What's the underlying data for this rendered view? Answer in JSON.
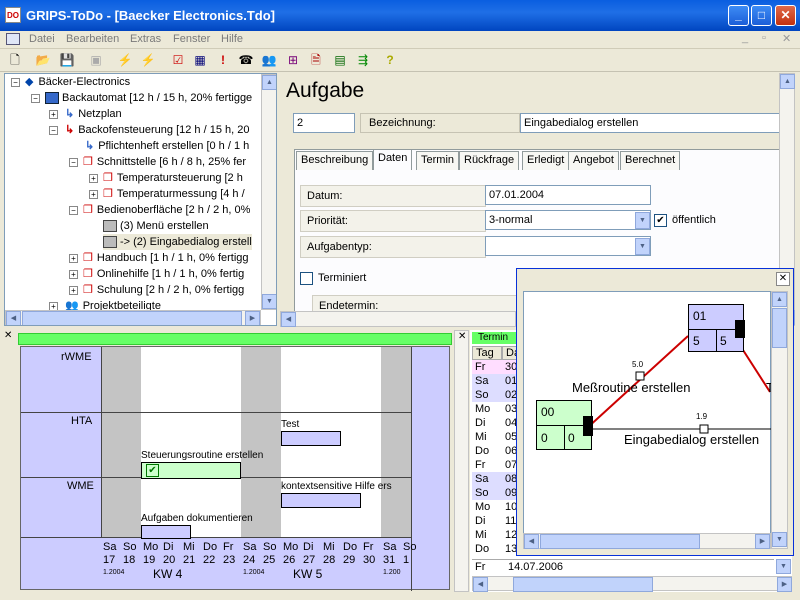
{
  "window": {
    "app_icon": "DO",
    "title": "GRIPS-ToDo - [Baecker Electronics.Tdo]"
  },
  "menu": [
    "Datei",
    "Bearbeiten",
    "Extras",
    "Fenster",
    "Hilfe"
  ],
  "tree": [
    {
      "label": "Bäcker-Electronics"
    },
    {
      "label": "Backautomat  [12 h / 15 h, 20% fertigge"
    },
    {
      "label": "Netzplan"
    },
    {
      "label": "Backofensteuerung  [12 h / 15 h, 20"
    },
    {
      "label": "Pflichtenheft erstellen  [0 h / 1 h"
    },
    {
      "label": "Schnittstelle  [6 h / 8 h, 25% fer"
    },
    {
      "label": "Temperatursteuerung  [2 h"
    },
    {
      "label": "Temperaturmessung  [4 h / "
    },
    {
      "label": "Bedienoberfläche  [2 h / 2 h, 0%"
    },
    {
      "label": "(3) Menü erstellen"
    },
    {
      "label": "-> (2) Eingabedialog erstell"
    },
    {
      "label": "Handbuch  [1 h / 1 h, 0% fertigg"
    },
    {
      "label": "Onlinehilfe  [1 h / 1 h, 0% fertig"
    },
    {
      "label": "Schulung  [2 h / 2 h, 0% fertigg"
    },
    {
      "label": "Projektbeteiligte"
    }
  ],
  "task": {
    "heading": "Aufgabe",
    "number": "2",
    "name_label": "Bezeichnung:",
    "name_value": "Eingabedialog erstellen",
    "tabs": [
      "Beschreibung",
      "Daten",
      "Termin",
      "Rückfrage",
      "Erledigt",
      "Angebot",
      "Berechnet"
    ],
    "date_label": "Datum:",
    "date_value": "07.01.2004",
    "priority_label": "Priorität:",
    "priority_value": "3-normal",
    "public_label": "öffentlich",
    "type_label": "Aufgabentyp:",
    "type_value": "",
    "scheduled_label": "Terminiert",
    "end_label": "Endetermin:"
  },
  "gantt": {
    "rows": [
      "rWME",
      "HTA",
      "WME"
    ],
    "bars": [
      {
        "label": "Test",
        "row": 1
      },
      {
        "label": "Steuerungsroutine erstellen",
        "row": 1
      },
      {
        "label": "kontextsensitive Hilfe ers",
        "row": 2
      },
      {
        "label": "Aufgaben dokumentieren",
        "row": 2
      }
    ],
    "days1": [
      "Sa",
      "So",
      "Mo",
      "Di",
      "Mi",
      "Do",
      "Fr",
      "Sa",
      "So",
      "Mo",
      "Di",
      "Mi",
      "Do",
      "Fr",
      "Sa",
      "So"
    ],
    "dates1": [
      "17",
      "18",
      "19",
      "20",
      "21",
      "22",
      "23",
      "24",
      "25",
      "26",
      "27",
      "28",
      "29",
      "30",
      "31",
      "1"
    ],
    "years": [
      "1.2004",
      "1.2004",
      "1.200"
    ],
    "weeks": [
      "KW 4",
      "KW 5"
    ]
  },
  "term": {
    "title": "Termin",
    "col_tag": "Tag",
    "col_da": "Da",
    "rows": [
      {
        "tag": "Fr",
        "d": "30"
      },
      {
        "tag": "Sa",
        "d": "01"
      },
      {
        "tag": "So",
        "d": "02"
      },
      {
        "tag": "Mo",
        "d": "03"
      },
      {
        "tag": "Di",
        "d": "04"
      },
      {
        "tag": "Mi",
        "d": "05"
      },
      {
        "tag": "Do",
        "d": "06"
      },
      {
        "tag": "Fr",
        "d": "07"
      },
      {
        "tag": "Sa",
        "d": "08"
      },
      {
        "tag": "So",
        "d": "09"
      },
      {
        "tag": "Mo",
        "d": "10"
      },
      {
        "tag": "Di",
        "d": "11"
      },
      {
        "tag": "Mi",
        "d": "12"
      },
      {
        "tag": "Do",
        "d": "13"
      }
    ],
    "last_tag": "Fr",
    "last_date": "14.07.2006"
  },
  "network": {
    "node00": {
      "id": "00",
      "a": "0",
      "b": "0"
    },
    "node01": {
      "id": "01",
      "a": "5",
      "b": "5"
    },
    "edge1_val": "5.0",
    "edge2_val": "1.9",
    "label1": "Meßroutine erstellen",
    "label2": "Eingabedialog erstellen",
    "label3": "T"
  }
}
